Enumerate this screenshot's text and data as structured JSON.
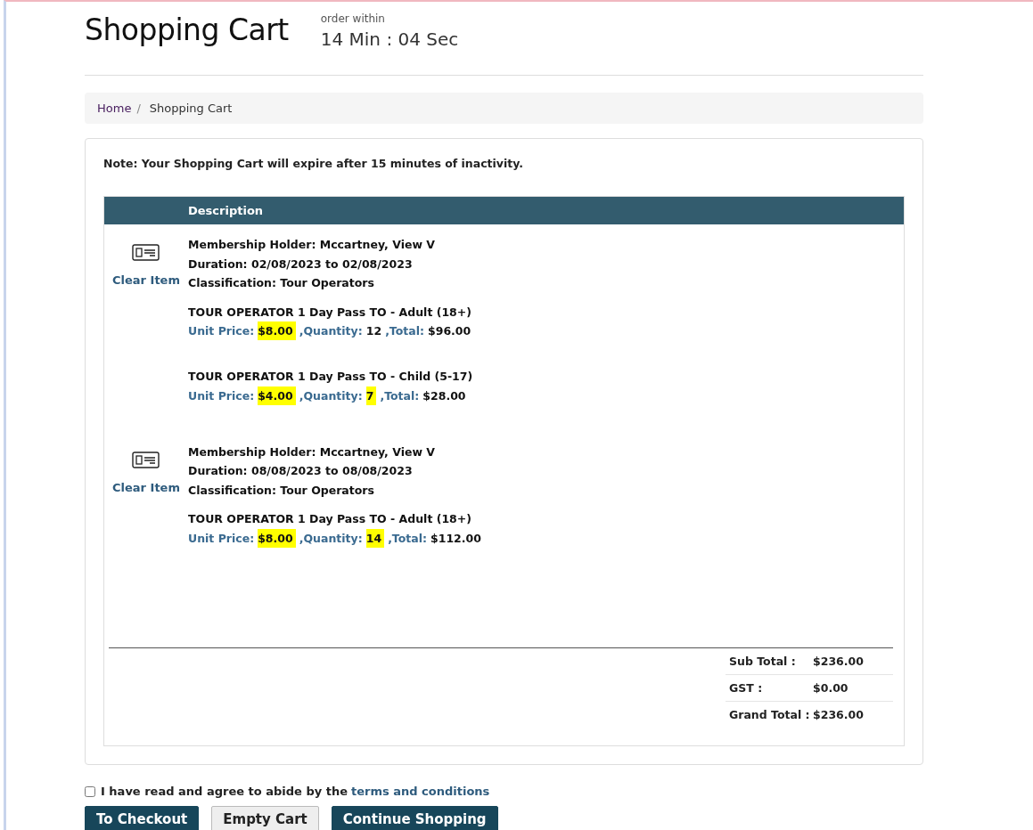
{
  "page_title": "Shopping Cart",
  "timer": {
    "label": "order within",
    "value": "14 Min : 04 Sec"
  },
  "breadcrumb_separator": "/",
  "breadcrumb": [
    {
      "label": "Home",
      "selected": false
    },
    {
      "label": "Shopping Cart",
      "selected": true
    }
  ],
  "note": "Note: Your Shopping Cart will expire after 15 minutes of inactivity.",
  "table": {
    "column_1": "Description",
    "items": [
      {
        "clear": "Clear Item",
        "details": [
          "Membership Holder: Mccartney, View V",
          "Duration: 02/08/2023 to 02/08/2023",
          "Classification: Tour Operators"
        ],
        "passes": [
          {
            "name": "TOUR OPERATOR 1 Day Pass TO - Adult (18+)",
            "price_label": "Unit Price:",
            "price": "$8.00",
            "price_highlighted": true,
            "qty_label": ",Quantity:",
            "qty": "12",
            "qty_highlighted": false,
            "total_label": ",Total:",
            "total": "$96.00"
          },
          {
            "name": "TOUR OPERATOR 1 Day Pass TO - Child (5-17)",
            "price_label": "Unit Price:",
            "price": "$4.00",
            "price_highlighted": true,
            "qty_label": ",Quantity:",
            "qty": "7",
            "qty_highlighted": true,
            "total_label": ",Total:",
            "total": "$28.00"
          }
        ]
      },
      {
        "clear": "Clear Item",
        "details": [
          "Membership Holder: Mccartney, View V",
          "Duration: 08/08/2023 to 08/08/2023",
          "Classification: Tour Operators"
        ],
        "passes": [
          {
            "name": "TOUR OPERATOR 1 Day Pass TO - Adult (18+)",
            "price_label": "Unit Price:",
            "price": "$8.00",
            "price_highlighted": true,
            "qty_label": ",Quantity:",
            "qty": "14",
            "qty_highlighted": true,
            "total_label": ",Total:",
            "total": "$112.00"
          }
        ]
      }
    ],
    "totals": [
      {
        "label": "Sub Total :",
        "value": "$236.00"
      },
      {
        "label": "GST :",
        "value": "$0.00"
      },
      {
        "label": "Grand Total :",
        "value": "$236.00"
      }
    ]
  },
  "terms": {
    "checked": false,
    "text": "I have read and agree to abide by the",
    "link": "terms and conditions"
  },
  "buttons": [
    {
      "label": "To Checkout",
      "kind": "primary"
    },
    {
      "label": "Empty Cart",
      "kind": "secondary"
    },
    {
      "label": "Continue Shopping",
      "kind": "primary"
    }
  ]
}
